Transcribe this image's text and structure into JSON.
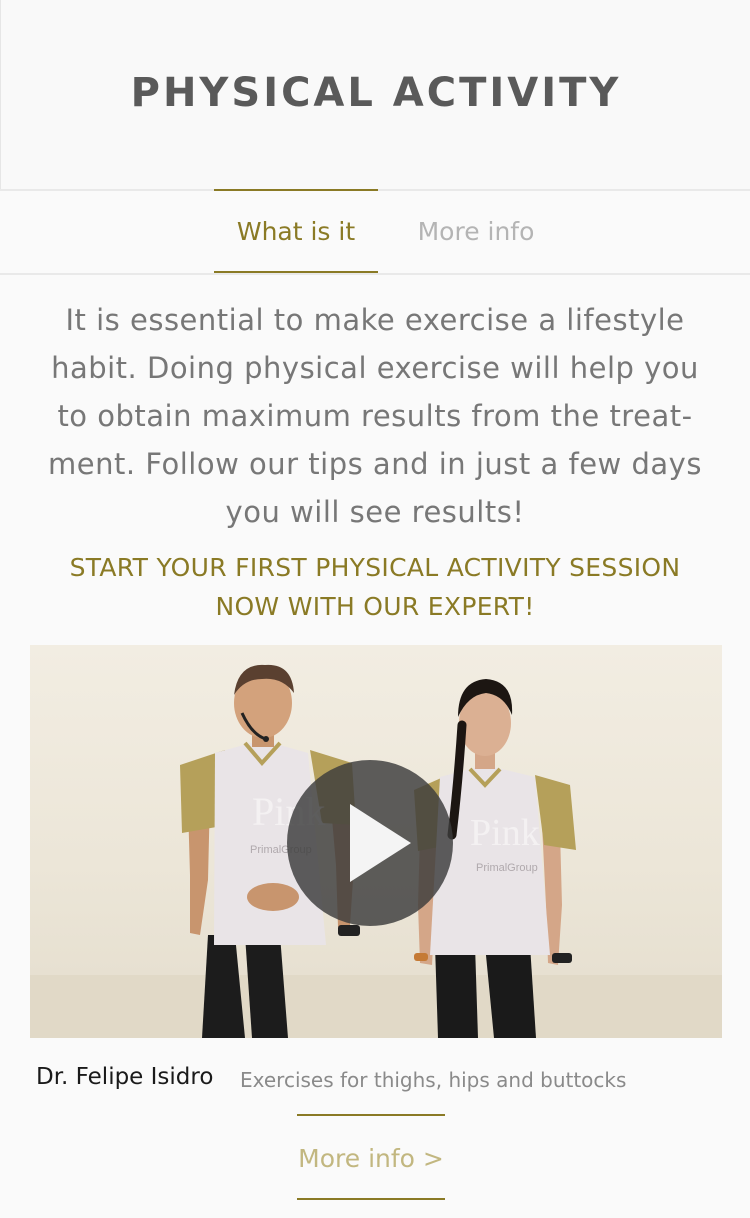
{
  "header": {
    "title": "PHYSICAL ACTIVITY"
  },
  "tabs": [
    {
      "label": "What is it",
      "active": true
    },
    {
      "label": "More info",
      "active": false
    }
  ],
  "intro": {
    "lines": [
      "It is essential to make exercise a lifestyle",
      "habit. Doing physical exercise will help you",
      "to obtain maximum results from the treat-",
      "ment. Follow our tips and in just a few days",
      "you will see results!"
    ]
  },
  "cta": {
    "lines": [
      "START YOUR FIRST PHYSICAL ACTIVITY SESSION",
      "NOW WITH OUR EXPERT!"
    ]
  },
  "video": {
    "play_icon": "play-icon",
    "shirt_logo_lines": [
      "Pink",
      "PrimalGroup"
    ]
  },
  "caption": {
    "name": "Dr. Felipe Isidro",
    "description": "Exercises for thighs, hips and buttocks"
  },
  "more_link": {
    "label": "More info >"
  },
  "colors": {
    "accent": "#8a7a25",
    "accent_light": "#c2b780",
    "title": "#5a5a5a",
    "body_text": "#777777",
    "inactive_tab": "#b4b4b4",
    "background": "#fafafa"
  }
}
